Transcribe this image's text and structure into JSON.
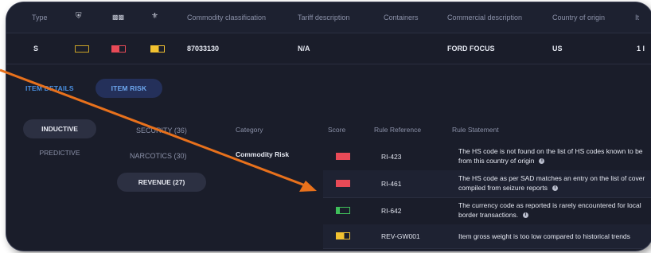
{
  "header": {
    "columns": [
      "Type",
      "Commodity classification",
      "Tariff description",
      "Containers",
      "Commercial description",
      "Country of origin",
      "It"
    ],
    "icons": [
      "shield-icon",
      "badge-icon",
      "eagle-icon"
    ]
  },
  "item": {
    "type": "S",
    "commodity_classification": "87033130",
    "tariff_description": "N/A",
    "containers": "",
    "commercial_description": "FORD FOCUS",
    "country_of_origin": "US",
    "item_no": "1 I",
    "risk_colors": {
      "shield": "#1a1d2a",
      "badge": "#e84a57",
      "eagle": "#f2c230"
    }
  },
  "tabs": {
    "details": "ITEM DETAILS",
    "risk": "ITEM RISK"
  },
  "risk_types": {
    "inductive": "INDUCTIVE",
    "predictive": "PREDICTIVE"
  },
  "categories": {
    "security": "SECURITY (36)",
    "narcotics": "NARCOTICS (30)",
    "revenue": "REVENUE (27)"
  },
  "rules_table": {
    "headers": {
      "category": "Category",
      "score": "Score",
      "reference": "Rule Reference",
      "statement": "Rule Statement"
    },
    "category_value": "Commodity Risk",
    "rows": [
      {
        "score_color": "#e84a57",
        "score_fill": 1.0,
        "reference": "RI-423",
        "statement": "The HS code is not found on the list of HS codes known to be",
        "statement2": "from this country of origin"
      },
      {
        "score_color": "#e84a57",
        "score_fill": 1.0,
        "reference": "RI-461",
        "statement": "The HS code as per SAD matches an entry on the list of cover",
        "statement2": "compiled from seizure reports"
      },
      {
        "score_color": "#3fbf5a",
        "score_fill": 0.25,
        "reference": "RI-642",
        "statement": "The currency code as reported is rarely encountered for local",
        "statement2": "border transactions."
      },
      {
        "score_color": "#f2c230",
        "score_fill": 0.6,
        "reference": "REV-GW001",
        "statement": "Item gross weight is too low compared to historical trends",
        "statement2": ""
      }
    ]
  },
  "colors": {
    "accent": "#4a8fe0",
    "arrow": "#e8711c"
  }
}
